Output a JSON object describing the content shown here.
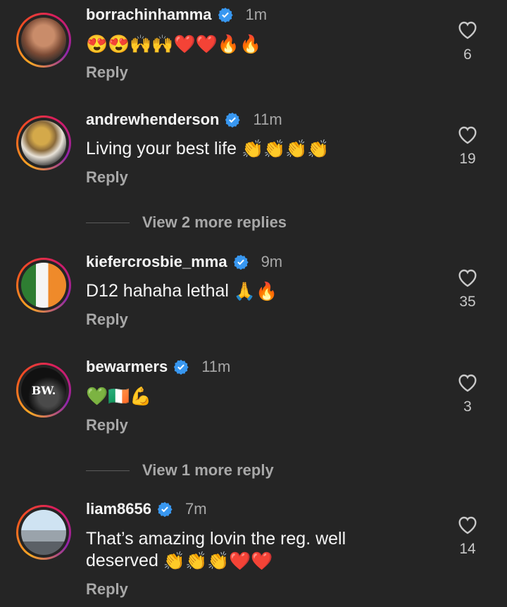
{
  "comments": [
    {
      "username": "borrachinhamma",
      "time": "1m",
      "text": "",
      "emojis": [
        "😍",
        "😍",
        "🙌",
        "🙌",
        "❤️",
        "❤️",
        "🔥",
        "🔥"
      ],
      "likes": "6",
      "reply": "Reply"
    },
    {
      "username": "andrewhenderson",
      "time": "11m",
      "text": "Living your best life",
      "emojis": [
        "👏",
        "👏",
        "👏",
        "👏"
      ],
      "likes": "19",
      "reply": "Reply"
    },
    {
      "username": "kiefercrosbie_mma",
      "time": "9m",
      "text": "D12 hahaha lethal",
      "emojis": [
        "🙏",
        "🔥"
      ],
      "likes": "35",
      "reply": "Reply"
    },
    {
      "username": "bewarmers",
      "time": "11m",
      "text": "",
      "emojis": [
        "💚",
        "🇮🇪",
        "💪"
      ],
      "likes": "3",
      "reply": "Reply",
      "avatar_text": "BW."
    },
    {
      "username": "liam8656",
      "time": "7m",
      "text_line1": "That’s amazing lovin the reg. well",
      "text_line2": "deserved",
      "emojis": [
        "👏",
        "👏",
        "👏",
        "❤️",
        "❤️"
      ],
      "likes": "14",
      "reply": "Reply"
    }
  ],
  "view_more": [
    {
      "label": "View 2 more replies"
    },
    {
      "label": "View 1 more reply"
    }
  ],
  "colors": {
    "verified": "#3897f0",
    "background": "#252525"
  }
}
